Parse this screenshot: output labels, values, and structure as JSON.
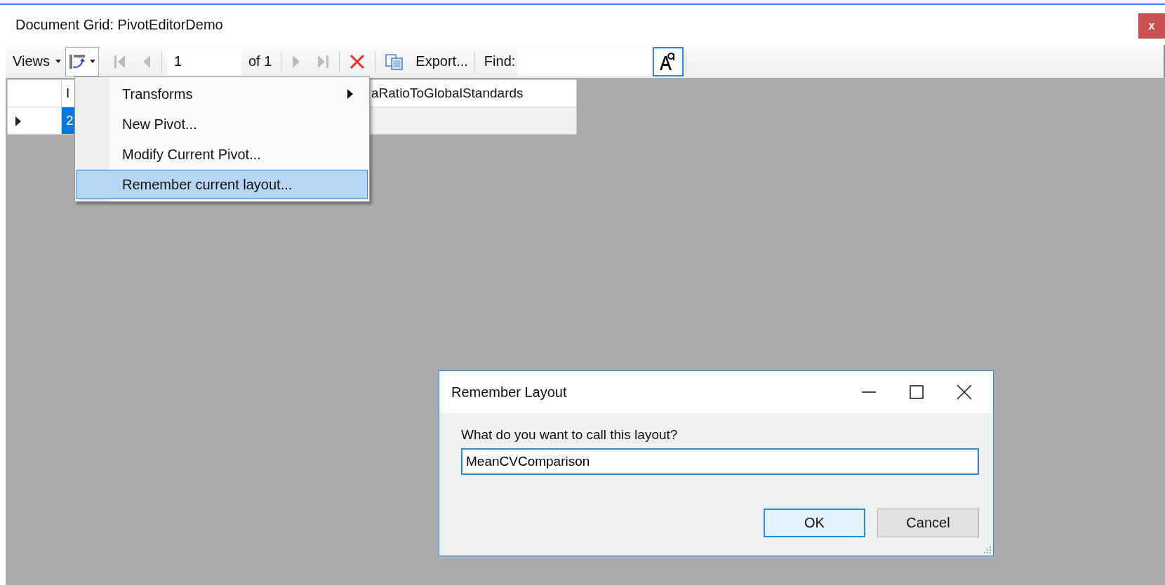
{
  "window": {
    "title": "Document Grid: PivotEditorDemo",
    "close_label": "x"
  },
  "toolbar": {
    "views_label": "Views",
    "page_field": {
      "value": "1"
    },
    "page_count": "of 1",
    "export_label": "Export...",
    "find_label": "Find:"
  },
  "grid": {
    "columns": [
      {
        "label": "I"
      },
      {
        "label": "aRatioToGlobalStandards"
      }
    ],
    "rows": [
      {
        "current": true,
        "cells": [
          {
            "text": "2",
            "selected": true
          }
        ]
      }
    ]
  },
  "menu": {
    "items": [
      {
        "label": "Transforms",
        "submenu": true,
        "selected": false
      },
      {
        "label": "New Pivot...",
        "submenu": false,
        "selected": false
      },
      {
        "label": "Modify Current Pivot...",
        "submenu": false,
        "selected": false
      },
      {
        "label": "Remember current layout...",
        "submenu": false,
        "selected": true
      }
    ]
  },
  "dialog": {
    "title": "Remember Layout",
    "prompt": "What do you want to call this layout?",
    "name_field": {
      "value": "MeanCVComparison"
    },
    "buttons": [
      {
        "label": "OK",
        "default": true
      },
      {
        "label": "Cancel",
        "default": false
      }
    ]
  }
}
